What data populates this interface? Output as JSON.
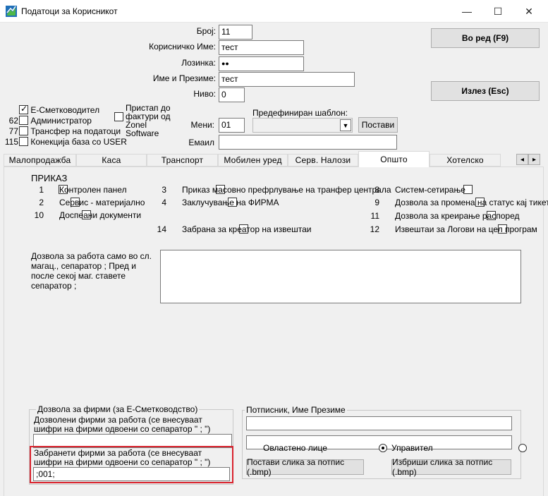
{
  "window": {
    "title": "Податоци за Корисникот",
    "minimize": "—",
    "maximize": "☐",
    "close": "✕"
  },
  "header": {
    "broj_label": "Број:",
    "broj_value": "11",
    "username_label": "Корисничко Име:",
    "username_value": "тест",
    "password_label": "Лозинка:",
    "password_value": "●●",
    "fullname_label": "Име и Презиме:",
    "fullname_value": "тест",
    "nivo_label": "Ниво:",
    "nivo_value": "0",
    "meni_label": "Мени:",
    "meni_value": "01",
    "email_label": "Емаил",
    "email_value": "",
    "template_label": "Предефиниран шаблон:",
    "template_value": "",
    "postavi_button": "Постави",
    "ok_button": "Во ред (F9)",
    "exit_button": "Излез (Esc)"
  },
  "roles": [
    {
      "num": "",
      "label": "Е-Сметководител",
      "checked": true
    },
    {
      "num": "62",
      "label": "Администратор",
      "checked": false
    },
    {
      "num": "77",
      "label": "Трансфер на податоци",
      "checked": false
    },
    {
      "num": "115",
      "label": "Конекција база со USER",
      "checked": false
    }
  ],
  "zonel_access": "Пристап до фактури од Zonel Software",
  "tabs": [
    "Малопродажба",
    "Каса",
    "Транспорт",
    "Мобилен уред",
    "Серв. Налози",
    "Општо",
    "Хотелско"
  ],
  "tab_scroll": {
    "left": "◂",
    "right": "▸"
  },
  "prikaz": {
    "title": "ПРИКАЗ",
    "col1": [
      {
        "num": "1",
        "label": "Контролен панел"
      },
      {
        "num": "2",
        "label": "Сервис - материјално"
      },
      {
        "num": "10",
        "label": "Доспеани документи"
      }
    ],
    "col2": [
      {
        "num": "3",
        "label": "Приказ масовно префрлување на транфер централа"
      },
      {
        "num": "4",
        "label": "Заклучување на ФИРМА"
      },
      {
        "num": "14",
        "label": "Забрана за креатор на извештаи"
      }
    ],
    "col3": [
      {
        "num": "8",
        "label": "Систем-сетирање"
      },
      {
        "num": "9",
        "label": "Дозвола за промена на статус кај тикет"
      },
      {
        "num": "11",
        "label": "Дозвола за креирање распоред"
      },
      {
        "num": "12",
        "label": "Извештаи за Логови на цел програм"
      }
    ]
  },
  "warehouse": {
    "label": "Дозвола за работа само во сл. магац., сепаратор  ; Пред и после секој маг. ставете сепаратор ;",
    "value": ""
  },
  "firms_group": {
    "title": "Дозвола за фирми (за Е-Сметководство)",
    "allowed_label": "Дозволени фирми за работа (се внесуваат шифри на фирми одвоени со сепаратор \" ; \")",
    "allowed_value": "",
    "forbidden_label": "Забранети фирми за работа (се внесуваат шифри на фирми одвоени со сепаратор \" ; \")",
    "forbidden_value": ";001;"
  },
  "signer_group": {
    "title": "Потписник, Име Презиме",
    "name_value": "",
    "radio1": "Овластено лице",
    "radio2": "Управител",
    "set_signature": "Постави слика за потпис (.bmp)",
    "delete_signature": "Избриши слика за потпис (.bmp)"
  },
  "colors": {
    "highlight": "#d9232e",
    "tab_active": "#ffffff"
  }
}
